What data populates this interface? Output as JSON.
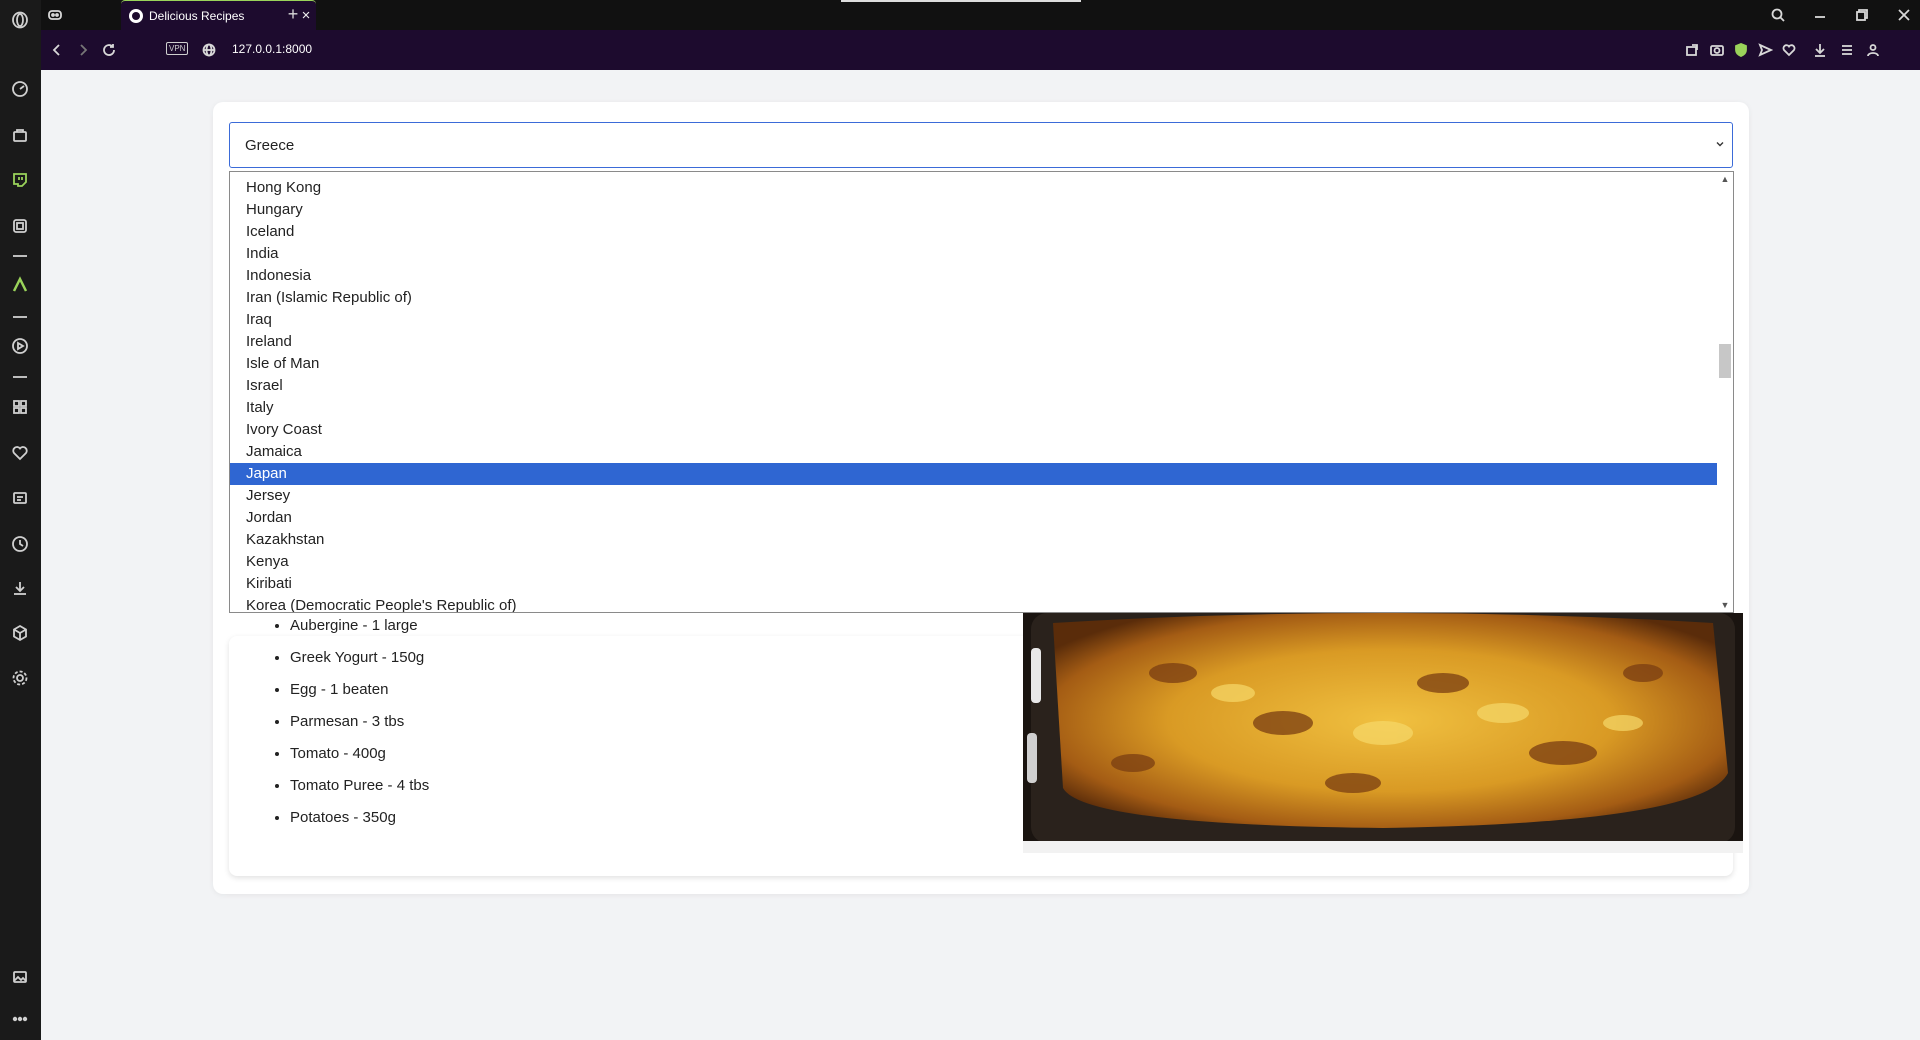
{
  "browser": {
    "tab_title": "Delicious Recipes",
    "tab_close": "×",
    "new_tab": "+",
    "vpn_label": "VPN",
    "url": "127.0.0.1:8000"
  },
  "sidebar": {
    "icons": [
      "opera-logo-icon",
      "speed-dial-icon",
      "shopping-icon",
      "twitch-icon",
      "crypto-wallet-icon",
      "aria-icon",
      "player-icon",
      "extensions-icon",
      "bookmarks-icon",
      "my-flow-icon",
      "history-icon",
      "downloads-icon",
      "cube-icon",
      "settings-icon",
      "image-icon",
      "more-icon"
    ]
  },
  "country_select": {
    "selected": "Greece",
    "options": [
      "Hong Kong",
      "Hungary",
      "Iceland",
      "India",
      "Indonesia",
      "Iran (Islamic Republic of)",
      "Iraq",
      "Ireland",
      "Isle of Man",
      "Israel",
      "Italy",
      "Ivory Coast",
      "Jamaica",
      "Japan",
      "Jersey",
      "Jordan",
      "Kazakhstan",
      "Kenya",
      "Kiribati",
      "Korea (Democratic People's Republic of)"
    ],
    "highlighted": "Japan"
  },
  "ingredients": [
    "Aubergine - 1 large",
    "Greek Yogurt - 150g",
    "Egg - 1 beaten",
    "Parmesan - 3 tbs",
    "Tomato - 400g",
    "Tomato Puree - 4 tbs",
    "Potatoes - 350g"
  ],
  "colors": {
    "accent": "#2f66d2",
    "browser_dark": "#1d0b2e",
    "tab_accent": "#9ad35a"
  }
}
